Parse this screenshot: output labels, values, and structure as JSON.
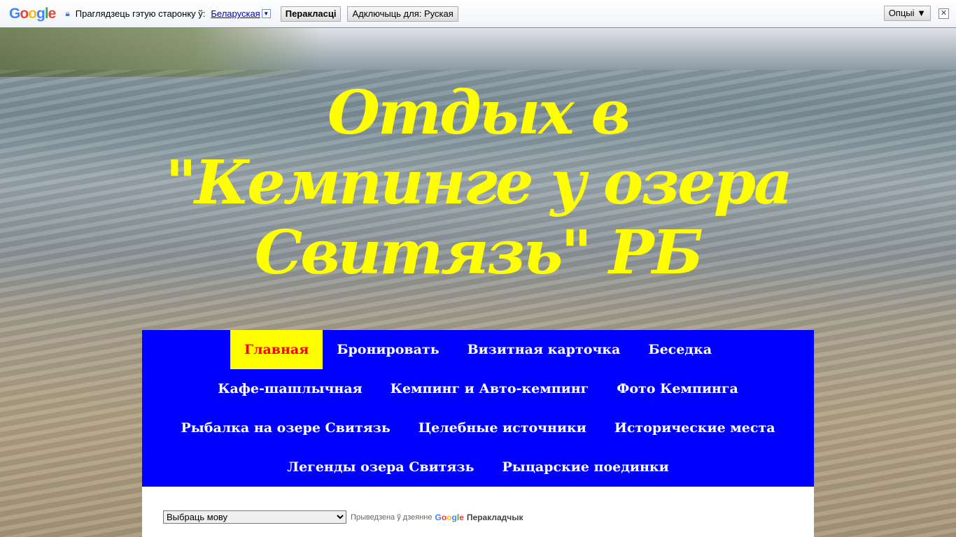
{
  "translate_bar": {
    "logo": "Google",
    "prompt": "Праглядзець гэтую старонку ў:",
    "language_link": "Беларуская",
    "translate_button": "Перакласці",
    "disable_button": "Адключыць для: Руская",
    "options_button": "Опцыі ▼",
    "close": "✕"
  },
  "header": {
    "title_lines": [
      "Отдых в",
      "\"Кемпинге у озера",
      "Свитязь\" РБ"
    ]
  },
  "nav": {
    "items": [
      {
        "label": "Главная",
        "active": true
      },
      {
        "label": "Бронировать"
      },
      {
        "label": "Визитная карточка"
      },
      {
        "label": "Беседка"
      },
      {
        "label": "Кафе-шашлычная"
      },
      {
        "label": "Кемпинг и Авто-кемпинг"
      },
      {
        "label": "Фото Кемпинга"
      },
      {
        "label": "Рыбалка на озере Свитязь"
      },
      {
        "label": "Целебные источники"
      },
      {
        "label": "Исторические места"
      },
      {
        "label": "Легенды озера Свитязь"
      },
      {
        "label": "Рыцарские поединки"
      }
    ],
    "colors": {
      "bg": "#0000ff",
      "active_bg": "#ffff00",
      "active_text": "#ff0000"
    }
  },
  "translator": {
    "select_value": "Выбраць мову",
    "powered_by": "Прыведзена ў дзеянне",
    "brand": "Google",
    "product": "Перакладчык"
  },
  "colors": {
    "title": "#ffff00"
  }
}
